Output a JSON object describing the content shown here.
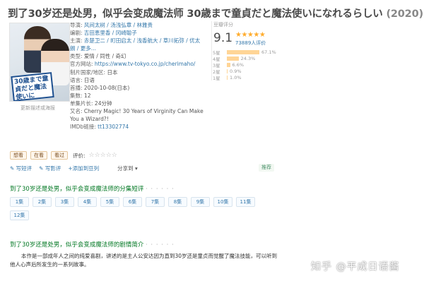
{
  "title": {
    "main": "到了30岁还是处男，似乎会变成魔法师 30歳まで童貞だと魔法使いになれるらしい",
    "year": "(2020)"
  },
  "poster": {
    "text": "30歳まで童貞だと魔法使いに",
    "link": "更新描述或海报"
  },
  "info": {
    "director_label": "导演:",
    "director": "风间太树 / 汤浅弘章 / 林雅贵",
    "writer_label": "编剧:",
    "writer": "吉田恵里香 / 冈崎聪子",
    "cast_label": "主演:",
    "cast": "赤楚卫二 / 町田启太 / 浅香航大 / 草川拓弥 / 优太朗 / 更多...",
    "type_label": "类型:",
    "type": "爱情 / 同性 / 奇幻",
    "site_label": "官方网站:",
    "site": "https://www.tv-tokyo.co.jp/cherimaho/",
    "country_label": "制片国家/地区:",
    "country": "日本",
    "language_label": "语言:",
    "language": "日语",
    "premiere_label": "首播:",
    "premiere": "2020-10-08(日本)",
    "episodes_label": "集数:",
    "episodes": "12",
    "runtime_label": "单集片长:",
    "runtime": "24分钟",
    "aka_label": "又名:",
    "aka": "Cherry Magic! 30 Years of Virginity Can Make You a Wizard?!",
    "imdb_label": "IMDb链接:",
    "imdb": "tt13302774"
  },
  "rating": {
    "label": "豆瓣评分",
    "score": "9.1",
    "stars": "★★★★★",
    "votes": "73889人评价",
    "distribution": [
      {
        "star": "5星",
        "percent": 67.1,
        "text": "67.1%"
      },
      {
        "star": "4星",
        "percent": 24.3,
        "text": "24.3%"
      },
      {
        "star": "3星",
        "percent": 6.6,
        "text": "6.6%"
      },
      {
        "star": "2星",
        "percent": 0.9,
        "text": "0.9%"
      },
      {
        "star": "1星",
        "percent": 1.0,
        "text": "1.0%"
      }
    ]
  },
  "actions": {
    "want": "想看",
    "watching": "在看",
    "watched": "看过",
    "rate_label": "评价:",
    "rate_stars": "☆☆☆☆☆"
  },
  "tools": {
    "short_review": "写短评",
    "long_review": "写影评",
    "add_list": "+添加到豆列",
    "share": "分享到",
    "recommend": "推荐"
  },
  "episodes_section": {
    "title": "到了30岁还是处男，似乎会变成魔法师的分集短评",
    "dots": "· · · · · ·",
    "items": [
      "1集",
      "2集",
      "3集",
      "4集",
      "5集",
      "6集",
      "7集",
      "8集",
      "9集",
      "10集",
      "11集",
      "12集"
    ]
  },
  "summary_section": {
    "title": "到了30岁还是处男，似乎会变成魔法师的剧情简介",
    "dots": "· · · · · ·",
    "text": "本作是一部成年人之间的纯爱喜剧，讲述的是主人公安达因为直到30岁还是童贞而觉醒了魔法技能，可以听到他人心声后所发生的一系列故事。"
  },
  "watermark": "知乎 @平成日语酱",
  "colors": {
    "link": "#3377aa",
    "section_green": "#007722",
    "star": "#ffac2d",
    "bar": "#ffd596"
  }
}
